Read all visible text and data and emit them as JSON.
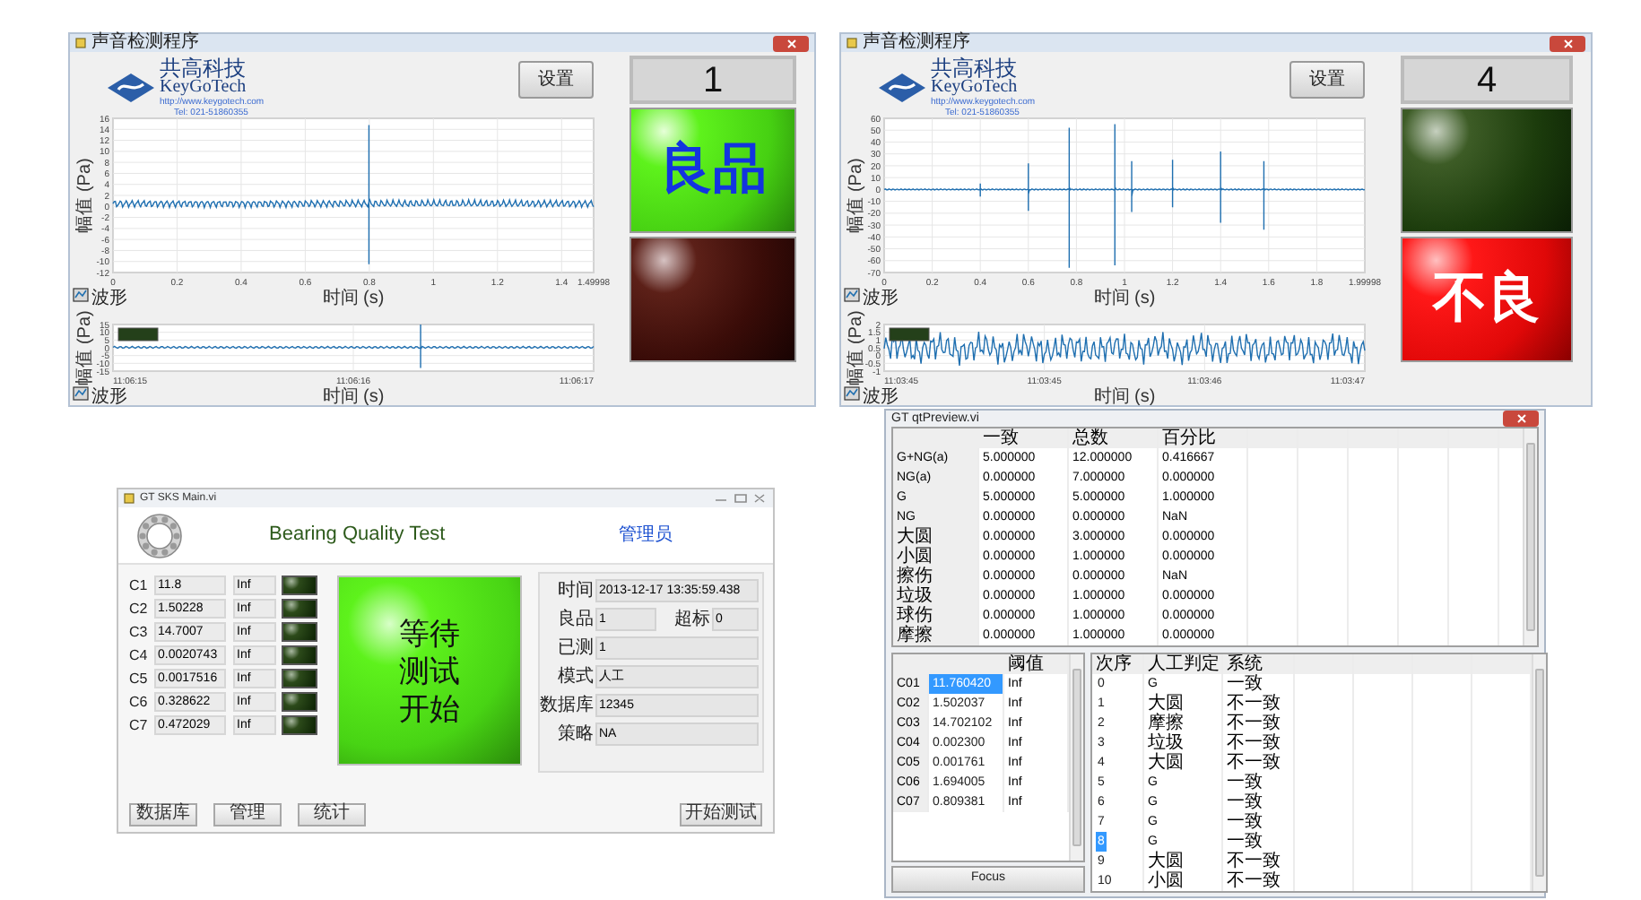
{
  "detector_windows": [
    {
      "title": "声音检测程序",
      "logo": {
        "cn": "共高科技",
        "en": "KeyGoTech",
        "url": "http://www.keygotech.com",
        "tel": "Tel: 021-51860355"
      },
      "settings_button": "设置",
      "count": "1",
      "main_chart": {
        "yticks": [
          "16",
          "14",
          "12",
          "10",
          "8",
          "6",
          "4",
          "2",
          "0",
          "-2",
          "-4",
          "-6",
          "-8",
          "-10",
          "-12"
        ],
        "xticks": [
          "0",
          "0.2",
          "0.4",
          "0.6",
          "0.8",
          "1",
          "1.2",
          "1.4",
          "1.49998"
        ],
        "xlabel": "时间 (s)",
        "ylabel": "幅值 (Pa)",
        "legend": "波形"
      },
      "history_chart": {
        "yticks": [
          "15",
          "10",
          "5",
          "0",
          "-5",
          "-10",
          "-15"
        ],
        "xticks": [
          "11:06:15",
          "11:06:16",
          "11:06:17"
        ],
        "xlabel": "时间 (s)",
        "ylabel": "幅值 (Pa)",
        "legend": "波形"
      },
      "lamps": [
        {
          "kind": "good",
          "on": true,
          "label": "良品"
        },
        {
          "kind": "bad",
          "on": false
        }
      ]
    },
    {
      "title": "声音检测程序",
      "logo": {
        "cn": "共高科技",
        "en": "KeyGoTech",
        "url": "http://www.keygotech.com",
        "tel": "Tel: 021-51860355"
      },
      "settings_button": "设置",
      "count": "4",
      "main_chart": {
        "yticks": [
          "60",
          "50",
          "40",
          "30",
          "20",
          "10",
          "0",
          "-10",
          "-20",
          "-30",
          "-40",
          "-50",
          "-60",
          "-70"
        ],
        "xticks": [
          "0",
          "0.2",
          "0.4",
          "0.6",
          "0.8",
          "1",
          "1.2",
          "1.4",
          "1.6",
          "1.8",
          "1.99998"
        ],
        "xlabel": "时间 (s)",
        "ylabel": "幅值 (Pa)",
        "legend": "波形"
      },
      "history_chart": {
        "yticks": [
          "2",
          "1.5",
          "1",
          "0.5",
          "0",
          "-0.5",
          "-1"
        ],
        "xticks": [
          "11:03:45",
          "11:03:45",
          "11:03:46",
          "11:03:47"
        ],
        "xlabel": "时间 (s)",
        "ylabel": "幅值 (Pa)",
        "legend": "波形"
      },
      "lamps": [
        {
          "kind": "good",
          "on": false
        },
        {
          "kind": "bad",
          "on": true,
          "label": "不良"
        }
      ]
    }
  ],
  "bearing_window": {
    "title": "GT SKS Main.vi",
    "heading": "Bearing Quality Test",
    "user_link": "管理员",
    "channels": [
      {
        "name": "C1",
        "value": "11.8",
        "limit": "Inf",
        "on": false
      },
      {
        "name": "C2",
        "value": "1.50228",
        "limit": "Inf",
        "on": false
      },
      {
        "name": "C3",
        "value": "14.7007",
        "limit": "Inf",
        "on": false
      },
      {
        "name": "C4",
        "value": "0.0020743",
        "limit": "Inf",
        "on": false
      },
      {
        "name": "C5",
        "value": "0.0017516",
        "limit": "Inf",
        "on": false
      },
      {
        "name": "C6",
        "value": "0.328622",
        "limit": "Inf",
        "on": false
      },
      {
        "name": "C7",
        "value": "0.472029",
        "limit": "Inf",
        "on": false
      }
    ],
    "status": "等待测试开始",
    "info_rows": [
      {
        "fields": [
          {
            "label": "时间",
            "value": "2013-12-17 13:35:59.438"
          }
        ]
      },
      {
        "fields": [
          {
            "label": "良品",
            "value": "1"
          },
          {
            "label": "超标",
            "value": "0"
          }
        ]
      },
      {
        "fields": [
          {
            "label": "已测",
            "value": "1"
          }
        ]
      },
      {
        "fields": [
          {
            "label": "模式",
            "value": "人工"
          }
        ]
      },
      {
        "fields": [
          {
            "label": "数据库",
            "value": "12345"
          }
        ]
      },
      {
        "fields": [
          {
            "label": "策略",
            "value": "NA"
          }
        ]
      }
    ],
    "buttons": [
      "数据库",
      "管理",
      "统计"
    ],
    "start_button": "开始测试"
  },
  "preview_window": {
    "title": "GT qtPreview.vi",
    "summary": {
      "columns": [
        "一致",
        "总数",
        "百分比"
      ],
      "rows": [
        {
          "label": "G+NG(a)",
          "cells": [
            "5.000000",
            "12.000000",
            "0.416667"
          ]
        },
        {
          "label": "NG(a)",
          "cells": [
            "0.000000",
            "7.000000",
            "0.000000"
          ]
        },
        {
          "label": "G",
          "cells": [
            "5.000000",
            "5.000000",
            "1.000000"
          ]
        },
        {
          "label": "NG",
          "cells": [
            "0.000000",
            "0.000000",
            "NaN"
          ]
        },
        {
          "label": "大圆",
          "cells": [
            "0.000000",
            "3.000000",
            "0.000000"
          ]
        },
        {
          "label": "小圆",
          "cells": [
            "0.000000",
            "1.000000",
            "0.000000"
          ]
        },
        {
          "label": "擦伤",
          "cells": [
            "0.000000",
            "0.000000",
            "NaN"
          ]
        },
        {
          "label": "垃圾",
          "cells": [
            "0.000000",
            "1.000000",
            "0.000000"
          ]
        },
        {
          "label": "球伤",
          "cells": [
            "0.000000",
            "1.000000",
            "0.000000"
          ]
        },
        {
          "label": "摩擦",
          "cells": [
            "0.000000",
            "1.000000",
            "0.000000"
          ]
        }
      ]
    },
    "features": {
      "columns": [
        "阈值"
      ],
      "rows": [
        {
          "name": "C01",
          "value": "11.760420",
          "limit": "Inf",
          "selected": true
        },
        {
          "name": "C02",
          "value": "1.502037",
          "limit": "Inf",
          "selected": false
        },
        {
          "name": "C03",
          "value": "14.702102",
          "limit": "Inf",
          "selected": false
        },
        {
          "name": "C04",
          "value": "0.002300",
          "limit": "Inf",
          "selected": false
        },
        {
          "name": "C05",
          "value": "0.001761",
          "limit": "Inf",
          "selected": false
        },
        {
          "name": "C06",
          "value": "1.694005",
          "limit": "Inf",
          "selected": false
        },
        {
          "name": "C07",
          "value": "0.809381",
          "limit": "Inf",
          "selected": false
        }
      ]
    },
    "focus_button": "Focus",
    "judgements": {
      "columns": [
        "次序",
        "人工判定",
        "系统"
      ],
      "rows": [
        {
          "index": "0",
          "manual": "G",
          "system": "一致",
          "selected": false
        },
        {
          "index": "1",
          "manual": "大圆",
          "system": "不一致",
          "selected": false
        },
        {
          "index": "2",
          "manual": "摩擦",
          "system": "不一致",
          "selected": false
        },
        {
          "index": "3",
          "manual": "垃圾",
          "system": "不一致",
          "selected": false
        },
        {
          "index": "4",
          "manual": "大圆",
          "system": "不一致",
          "selected": false
        },
        {
          "index": "5",
          "manual": "G",
          "system": "一致",
          "selected": false
        },
        {
          "index": "6",
          "manual": "G",
          "system": "一致",
          "selected": false
        },
        {
          "index": "7",
          "manual": "G",
          "system": "一致",
          "selected": false
        },
        {
          "index": "8",
          "manual": "G",
          "system": "一致",
          "selected": true
        },
        {
          "index": "9",
          "manual": "大圆",
          "system": "不一致",
          "selected": false
        },
        {
          "index": "10",
          "manual": "小圆",
          "system": "不一致",
          "selected": false
        }
      ]
    }
  }
}
